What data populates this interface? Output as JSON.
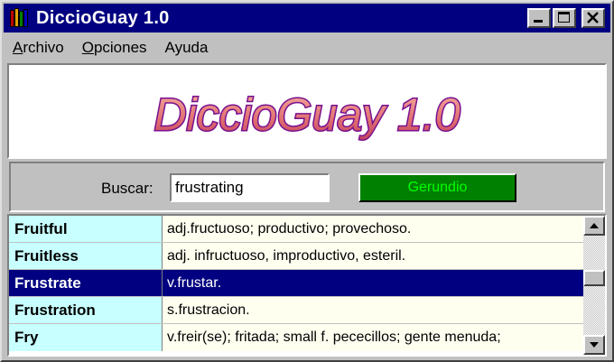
{
  "window": {
    "title": "DiccioGuay 1.0"
  },
  "menu": {
    "items": [
      {
        "accel": "A",
        "rest": "rchivo"
      },
      {
        "accel": "O",
        "rest": "pciones"
      },
      {
        "accel": "",
        "rest": "Ayuda"
      }
    ]
  },
  "logo": {
    "text": "DiccioGuay 1.0"
  },
  "search": {
    "label": "Buscar:",
    "value": "frustrating",
    "button_label": "Gerundio"
  },
  "entries": [
    {
      "word": "Fruitful",
      "definition": "adj.fructuoso; productivo; provechoso.",
      "selected": false
    },
    {
      "word": "Fruitless",
      "definition": "adj. infructuoso, improductivo, esteril.",
      "selected": false
    },
    {
      "word": "Frustrate",
      "definition": "v.frustar.",
      "selected": true
    },
    {
      "word": "Frustration",
      "definition": "s.frustracion.",
      "selected": false
    },
    {
      "word": "Fry",
      "definition": "v.freir(se); fritada; small f. pececillos; gente menuda;",
      "selected": false
    }
  ],
  "colors": {
    "titlebar": "#000080",
    "word_cell": "#c8ffff",
    "definition_cell": "#fffff0",
    "selection": "#000080",
    "button_bg": "#008000",
    "button_text": "#00ff00",
    "logo_fill": "#e08080",
    "logo_outline": "#7a1090"
  },
  "icons": {
    "app": "books-icon",
    "minimize": "minimize-icon",
    "maximize": "maximize-icon",
    "close": "close-icon",
    "scroll_up": "arrow-up-icon",
    "scroll_down": "arrow-down-icon"
  }
}
